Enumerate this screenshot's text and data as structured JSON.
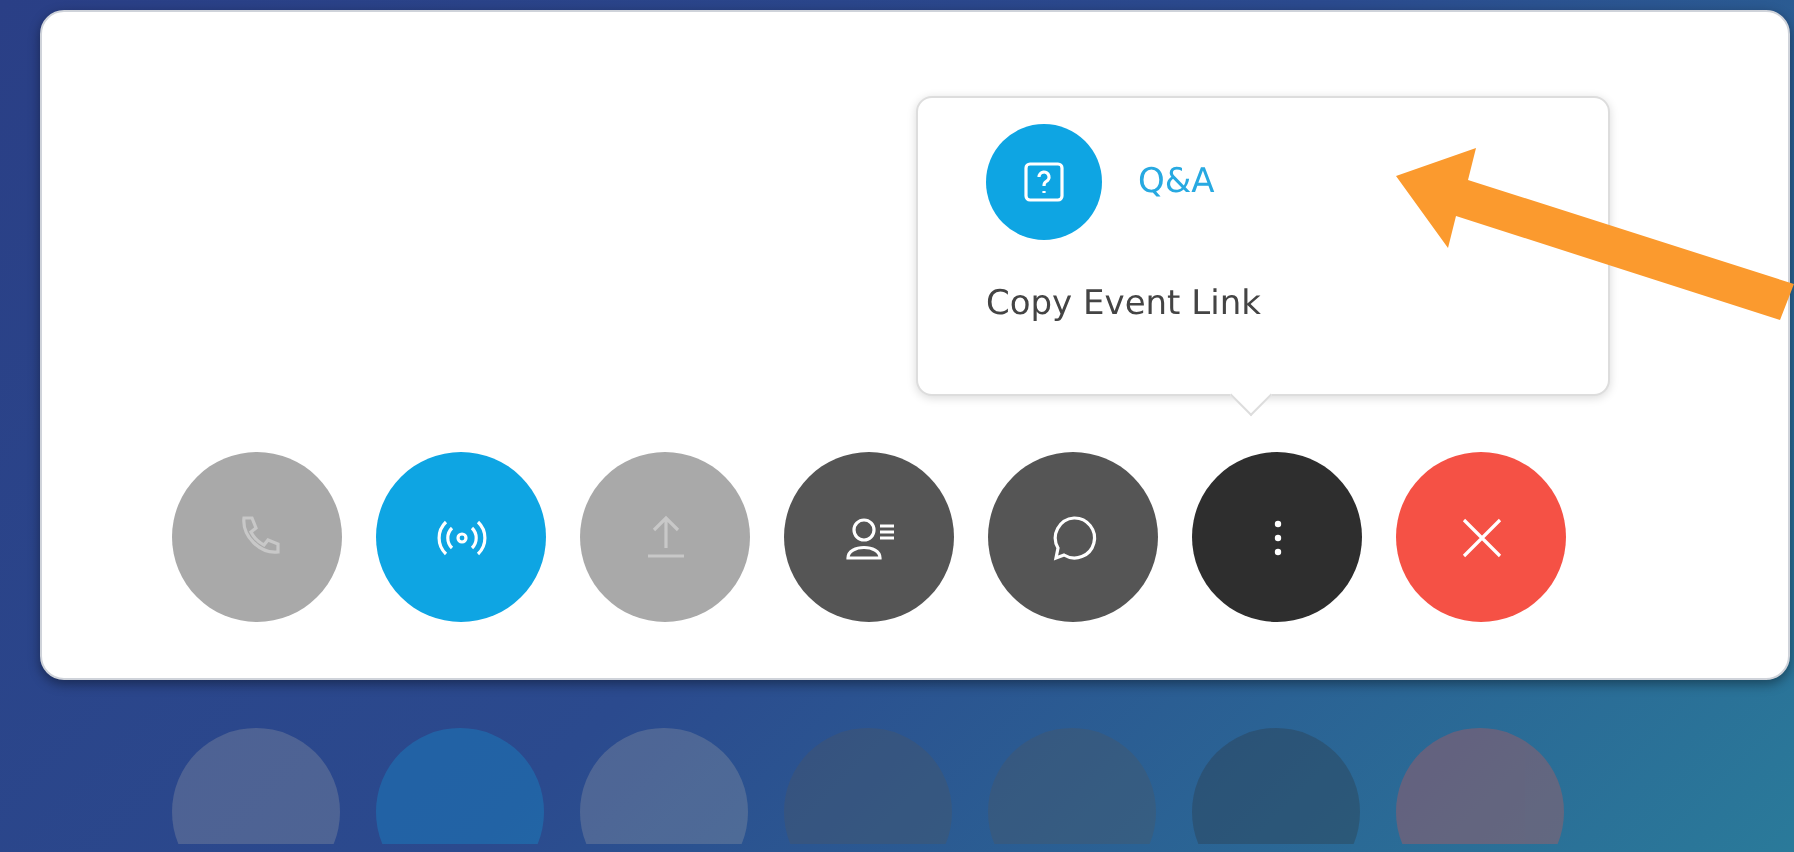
{
  "menu": {
    "items": [
      {
        "kind": "icon-link",
        "label": "Q&A"
      },
      {
        "kind": "plain",
        "label": "Copy Event Link"
      }
    ]
  },
  "controls": [
    {
      "kind": "disabled"
    },
    {
      "kind": "active"
    },
    {
      "kind": "disabled"
    },
    {
      "kind": "normal"
    },
    {
      "kind": "normal"
    },
    {
      "kind": "open"
    },
    {
      "kind": "end"
    }
  ]
}
